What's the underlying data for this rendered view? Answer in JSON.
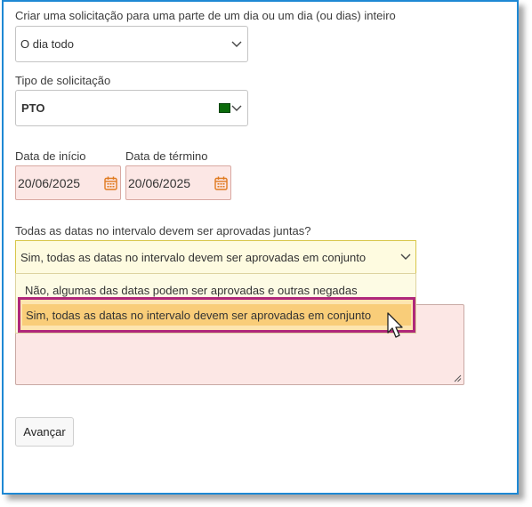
{
  "form": {
    "duration_label": "Criar uma solicitação para uma parte de um dia ou um dia (ou dias) inteiro",
    "duration_value": "O dia todo",
    "type_label": "Tipo de solicitação",
    "type_value": "PTO",
    "type_color": "#0b6b0b",
    "start_label": "Data de início",
    "start_value": "20/06/2025",
    "end_label": "Data de término",
    "end_value": "20/06/2025",
    "approval_label": "Todas as datas no intervalo devem ser aprovadas juntas?",
    "approval_value": "Sim, todas as datas no intervalo devem ser aprovadas em conjunto",
    "approval_options": [
      "Não, algumas das datas podem ser aprovadas e outras negadas",
      "Sim, todas as datas no intervalo devem ser aprovadas em conjunto"
    ],
    "next_button": "Avançar"
  },
  "colors": {
    "frame_border": "#1e88d4",
    "date_background": "#fce7e5",
    "dropdown_highlight": "#f9cd79",
    "highlight_border": "#b0277a",
    "calendar_icon": "#e07a1f"
  },
  "icons": [
    "chevron-down-icon",
    "calendar-icon",
    "resize-grip-icon",
    "mouse-pointer-icon"
  ]
}
